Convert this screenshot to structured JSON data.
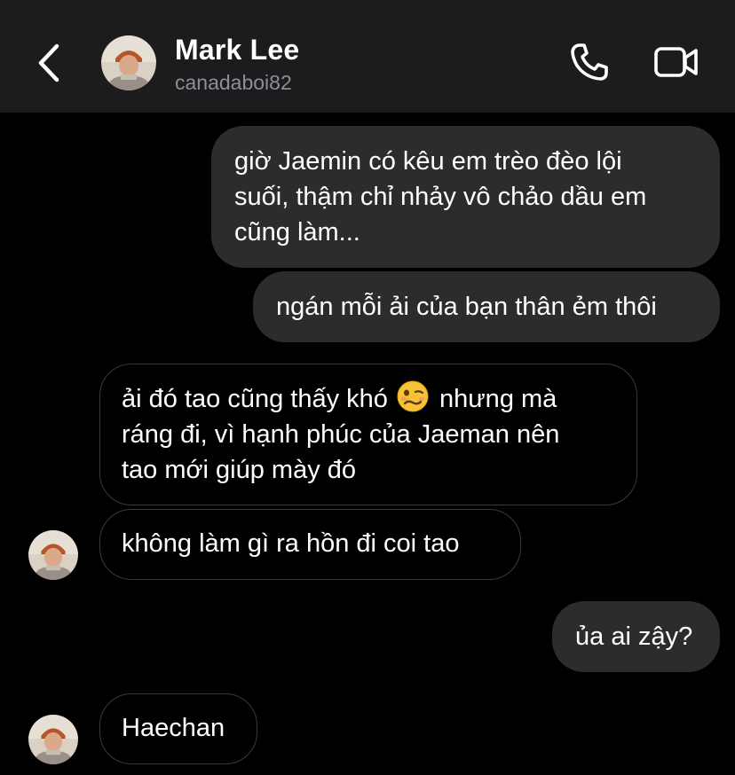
{
  "header": {
    "contact_name": "Mark Lee",
    "contact_handle": "canadaboi82",
    "icons": {
      "back": "chevron-left-icon",
      "call": "phone-icon",
      "video": "video-camera-icon"
    }
  },
  "messages": [
    {
      "direction": "sent",
      "lines": [
        "giờ Jaemin có kêu em trèo đèo lội",
        "suối, thậm chỉ nhảy vô chảo dầu em",
        "cũng làm..."
      ]
    },
    {
      "direction": "sent",
      "lines": [
        "ngán mỗi ải của bạn thân ẻm thôi"
      ]
    },
    {
      "direction": "received",
      "line1_before_emoji": "ải đó tao cũng thấy khó",
      "emoji": "woozy-face-emoji",
      "line1_after_emoji": "nhưng mà",
      "lines_rest": [
        "ráng đi, vì hạnh phúc của Jaeman nên",
        "tao mới giúp mày đó"
      ]
    },
    {
      "direction": "received",
      "lines": [
        "không làm gì ra hồn đi coi tao"
      ]
    },
    {
      "direction": "sent",
      "lines": [
        "ủa ai zậy?"
      ]
    },
    {
      "direction": "received",
      "lines": [
        "Haechan"
      ]
    }
  ],
  "colors": {
    "background": "#000000",
    "header_bg": "#1c1c1e",
    "sent_bubble": "#2c2c2e",
    "received_border": "#3a3a3c",
    "secondary_text": "#8e8e93"
  }
}
